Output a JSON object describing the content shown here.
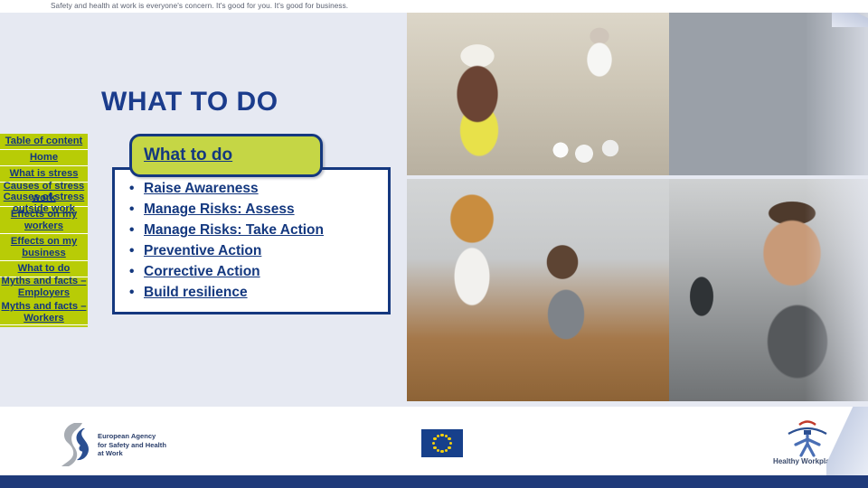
{
  "banner": {
    "tagline": "Safety and health at work is everyone's concern. It's good for you. It's good for business."
  },
  "slide": {
    "title": "WHAT TO DO"
  },
  "sidebar": {
    "items": [
      {
        "label": "Table of content"
      },
      {
        "label": "Home"
      },
      {
        "label": "What is stress"
      },
      {
        "label": "Causes of stress  work"
      },
      {
        "label": "Causes of stress outside work"
      },
      {
        "label": "Effects on my workers"
      },
      {
        "label": "Effects on my business"
      },
      {
        "label": "What to do"
      },
      {
        "label": "Myths and facts – Employers"
      },
      {
        "label": "Myths and facts – Workers"
      }
    ]
  },
  "active_tab": {
    "label": "What to do"
  },
  "content": {
    "bullet_char": "•",
    "bullets": [
      {
        "label": "Raise Awareness"
      },
      {
        "label": "Manage Risks: Assess"
      },
      {
        "label": "Manage Risks: Take Action"
      },
      {
        "label": "Preventive Action"
      },
      {
        "label": "Corrective Action"
      },
      {
        "label": "Build resilience"
      }
    ]
  },
  "footer": {
    "osha_logo": {
      "line1": "European Agency",
      "line2": "for Safety and Health",
      "line3": "at Work"
    },
    "eu_flag_name": "european-union-flag",
    "healthy_workplaces": {
      "label": "Healthy Workplaces"
    }
  },
  "colors": {
    "brand_blue": "#14387f",
    "accent_green": "#b8cc06",
    "tab_green": "#c5d645",
    "page_background": "#e6e9f2",
    "footer_strip": "#1f3a7a",
    "eu_flag_blue": "#17408b",
    "eu_star_yellow": "#f4d00c"
  }
}
